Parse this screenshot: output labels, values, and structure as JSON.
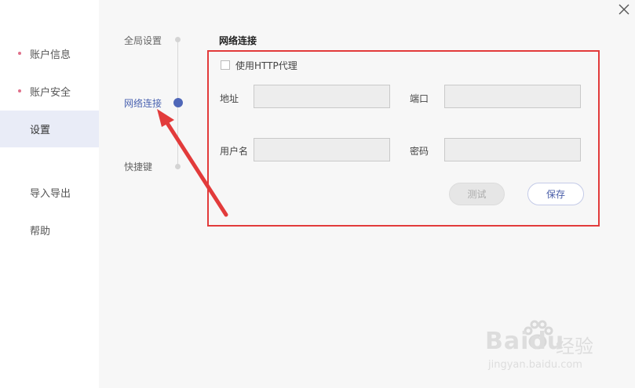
{
  "sidebar": {
    "items": [
      {
        "label": "账户信息"
      },
      {
        "label": "账户安全"
      },
      {
        "label": "设置"
      },
      {
        "label": "导入导出"
      },
      {
        "label": "帮助"
      }
    ]
  },
  "steps": [
    {
      "label": "全局设置"
    },
    {
      "label": "网络连接"
    },
    {
      "label": "快捷键"
    }
  ],
  "section": {
    "title": "网络连接",
    "proxy_checkbox_label": "使用HTTP代理",
    "proxy_checked": false,
    "address_label": "地址",
    "address_value": "",
    "port_label": "端口",
    "port_value": "",
    "username_label": "用户名",
    "username_value": "",
    "password_label": "密码",
    "password_value": "",
    "test_button": "测试",
    "save_button": "保存"
  },
  "watermark": {
    "brand": "Baidu",
    "brand_suffix": "经验",
    "url": "jingyan.baidu.com"
  },
  "colors": {
    "accent": "#4f67b8",
    "highlight": "#e23b3b",
    "sidebar_dot": "#e0708a",
    "active_bg": "#e9ecf7"
  }
}
